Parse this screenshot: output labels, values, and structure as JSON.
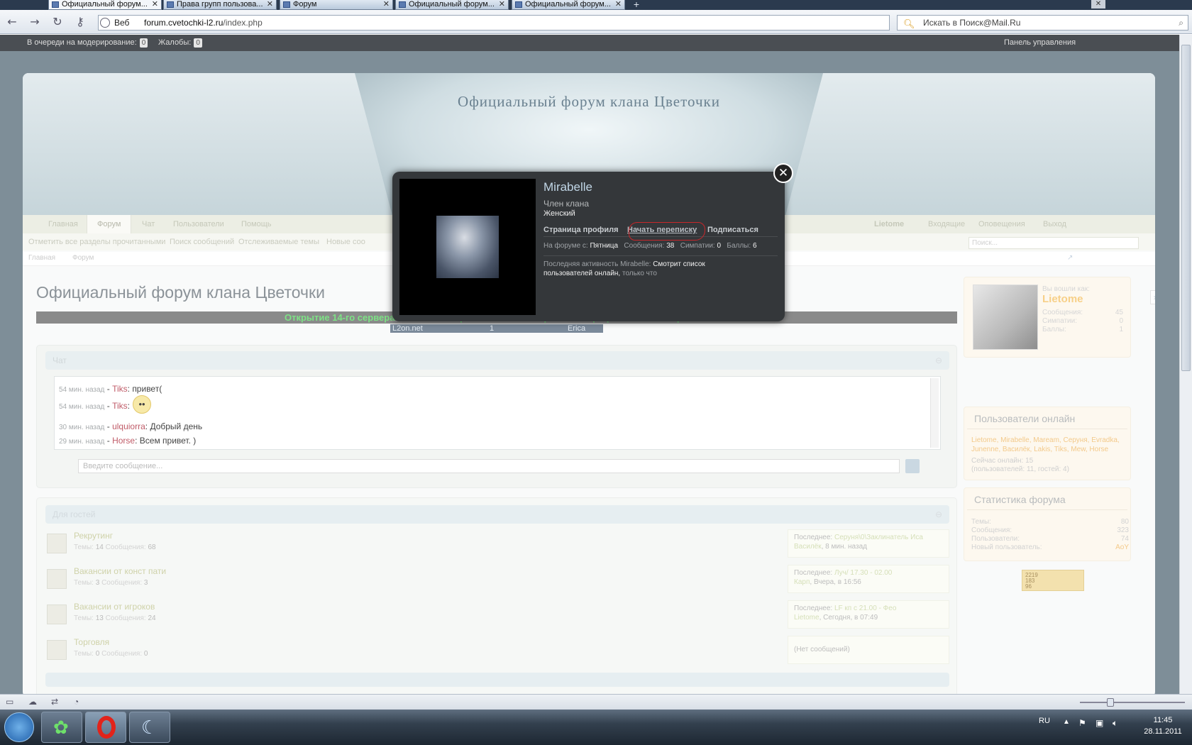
{
  "browser": {
    "tabs": [
      "Официальный форум...",
      "Права групп пользова...",
      "Форум",
      "Официальный форум...",
      "Официальный форум..."
    ],
    "web_label": "Веб",
    "url_domain": "forum.cvetochki-l2.ru",
    "url_path": "/index.php",
    "search_placeholder": "Искать в Поиск@Mail.Ru"
  },
  "modbar": {
    "queue_label": "В очереди на модерирование:",
    "queue_count": "0",
    "complaints_label": "Жалобы:",
    "complaints_count": "0",
    "panel_label": "Панель управления"
  },
  "header": {
    "banner_title": "Официальный форум клана Цветочки"
  },
  "nav": {
    "tabs": [
      "Главная",
      "Форум",
      "Чат",
      "Пользователи",
      "Помощь"
    ],
    "user": "Lietome",
    "inbox": "Входящие",
    "alerts": "Оповещения",
    "logout": "Выход"
  },
  "subnav": {
    "links": [
      "Отметить все разделы прочитанными",
      "Поиск сообщений",
      "Отслеживаемые темы",
      "Новые соо"
    ],
    "search_placeholder": "Поиск..."
  },
  "breadcrumbs": [
    "Главная",
    "Форум"
  ],
  "page_title": "Официальный форум клана Цветочки",
  "announcement": "Открытие 14-го сервера Erica запланировано на 29 ноября после профилактических работ !",
  "l2bar": {
    "site": "L2on.net",
    "num": "1",
    "server": "Erica"
  },
  "chat": {
    "header": "Чат",
    "messages": [
      {
        "time": "54 мин. назад",
        "user": "Tiks",
        "text": "привет("
      },
      {
        "time": "54 мин. назад",
        "user": "Tiks",
        "text": ""
      },
      {
        "time": "30 мин. назад",
        "user": "ulquiorra",
        "text": "Добрый день"
      },
      {
        "time": "29 мин. назад",
        "user": "Horse",
        "text": "Всем привет. )"
      }
    ],
    "input_placeholder": "Введите сообщение..."
  },
  "forum": {
    "header": "Для гостей",
    "rows": [
      {
        "title": "Рекрутинг",
        "threads": "14",
        "posts": "68",
        "last_label": "Последнее:",
        "last_title": "Серуня\\0\\Заклинатель Иса",
        "last_user": "Василёк",
        "last_time": "8 мин. назад"
      },
      {
        "title": "Вакансии от конст пати",
        "threads": "3",
        "posts": "3",
        "last_label": "Последнее:",
        "last_title": "Луч/ 17.30 - 02.00",
        "last_user": "Карп",
        "last_time": "Вчера, в 16:56"
      },
      {
        "title": "Вакансии от игроков",
        "threads": "13",
        "posts": "24",
        "last_label": "Последнее:",
        "last_title": "LF кп с 21.00 - Фео",
        "last_user": "Lietome",
        "last_time": "Сегодня, в 07:49"
      },
      {
        "title": "Торговля",
        "threads": "0",
        "posts": "0",
        "last_label": "(Нет сообщений)",
        "last_title": "",
        "last_user": "",
        "last_time": ""
      }
    ],
    "threads_label": "Темы:",
    "posts_label": "Сообщения:"
  },
  "sidebar": {
    "logged_as": "Вы вошли как:",
    "username": "Lietome",
    "stats": [
      {
        "k": "Сообщения:",
        "v": "45"
      },
      {
        "k": "Симпатии:",
        "v": "0"
      },
      {
        "k": "Баллы:",
        "v": "1"
      }
    ],
    "online_title": "Пользователи онлайн",
    "online_users": "Lietome, Mirabelle, Maream, Серуня, Evradka, Junenne, Василёк, Lakis, Tiks, Mew, Horse",
    "online_now": "Сейчас онлайн: 15",
    "online_detail": "(пользователей: 11, гостей: 4)",
    "stats_title": "Статистика форума",
    "forum_stats": [
      {
        "k": "Темы:",
        "v": "80"
      },
      {
        "k": "Сообщения:",
        "v": "323"
      },
      {
        "k": "Пользователи:",
        "v": "74"
      },
      {
        "k": "Новый пользователь:",
        "v": "AoY"
      }
    ],
    "counter": "2219\n183\n96"
  },
  "modal": {
    "name": "Mirabelle",
    "rank": "Член клана",
    "gender": "Женский",
    "links": [
      "Страница профиля",
      "Начать переписку",
      "Подписаться"
    ],
    "since_label": "На форуме с:",
    "since": "Пятница",
    "posts_label": "Сообщения:",
    "posts": "38",
    "likes_label": "Симпатии:",
    "likes": "0",
    "points_label": "Баллы:",
    "points": "6",
    "activity_label": "Последняя активность Mirabelle:",
    "activity": "Смотрит список пользователей онлайн,",
    "activity_time": "только что"
  },
  "taskbar": {
    "lang": "RU",
    "time": "11:45",
    "date": "28.11.2011"
  }
}
